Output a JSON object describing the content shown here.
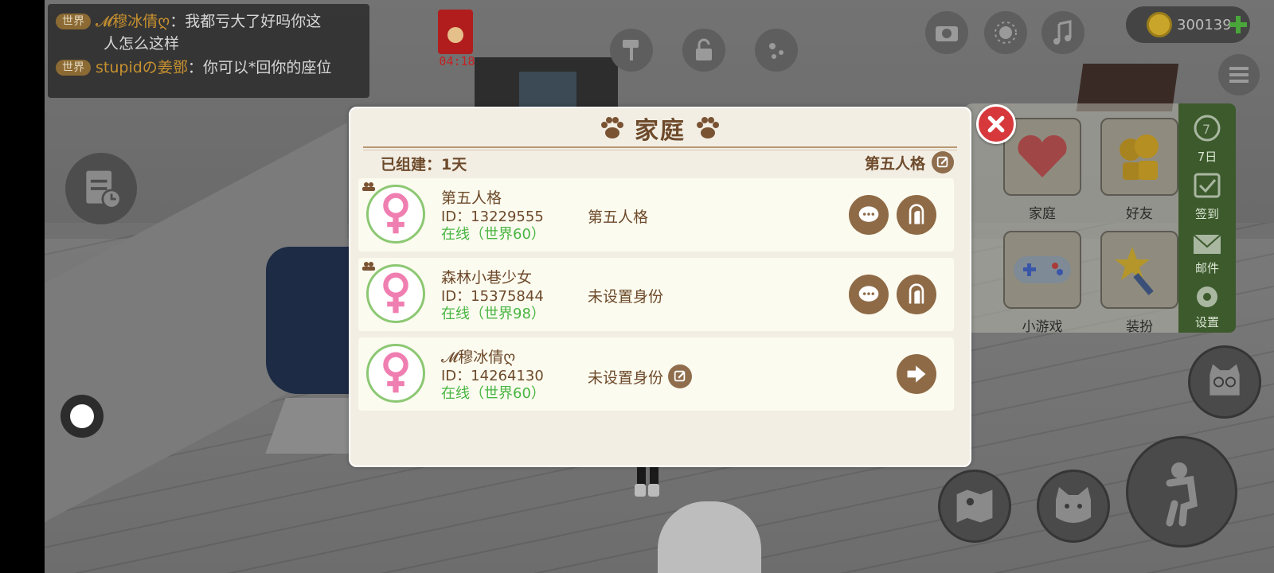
{
  "chat": {
    "messages": [
      {
        "channel": "世界",
        "sender": "𝓜穆冰倩ღ",
        "separator": "：",
        "text": "我都亏大了好吗你这",
        "continuation": "人怎么这样"
      },
      {
        "channel": "世界",
        "sender": "stupidの姜鄧",
        "separator": "：",
        "text": "你可以*回你的座位",
        "continuation": ""
      }
    ]
  },
  "event": {
    "timer": "04:18"
  },
  "currency": {
    "coins": "300139"
  },
  "side_menu": {
    "tiles": [
      {
        "label": "家庭",
        "icon": "heart-face-icon"
      },
      {
        "label": "好友",
        "icon": "friends-icon"
      },
      {
        "label": "小游戏",
        "icon": "gamepad-icon"
      },
      {
        "label": "装扮",
        "icon": "magic-wand-icon"
      }
    ],
    "strip": [
      {
        "label": "7日",
        "icon": "seven-day-icon"
      },
      {
        "label": "签到",
        "icon": "checkin-icon"
      },
      {
        "label": "邮件",
        "icon": "mail-icon"
      },
      {
        "label": "设置",
        "icon": "gear-icon"
      }
    ]
  },
  "dialog": {
    "title": "家庭",
    "created_label": "已组建：1天",
    "family_name": "第五人格",
    "members": [
      {
        "name": "第五人格",
        "id": "ID：13229555",
        "status": "在线（世界60）",
        "role": "第五人格",
        "actions": [
          "chat",
          "visit"
        ],
        "is_admin": true
      },
      {
        "name": "森林小巷少女",
        "id": "ID：15375844",
        "status": "在线（世界98）",
        "role": "未设置身份",
        "actions": [
          "chat",
          "visit"
        ],
        "is_admin": true
      },
      {
        "name": "𝓜穆冰倩ღ",
        "id": "ID：14264130",
        "status": "在线（世界60）",
        "role": "未设置身份",
        "actions": [
          "leave"
        ],
        "is_admin": false,
        "role_editable": true
      }
    ]
  },
  "colors": {
    "dialog_bg": "#f2eee4",
    "brown": "#6d4a2b",
    "online_green": "#48b542",
    "close_red": "#d7383c",
    "female_pink": "#f07fb1"
  }
}
